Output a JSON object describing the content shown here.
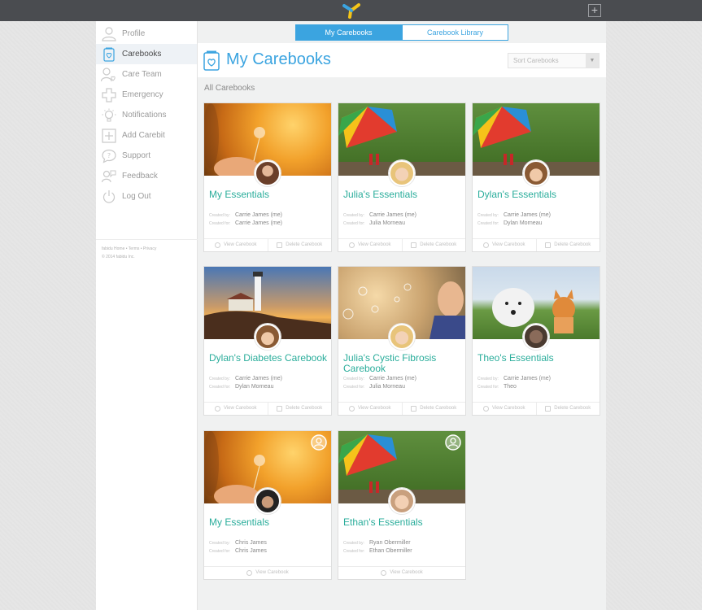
{
  "topbar": {
    "logo_icon": "carebook-logo-icon",
    "add_label": "+"
  },
  "colors": {
    "accent_blue": "#3ba4e0",
    "title_teal": "#2aad9b",
    "topbar": "#4a4c50"
  },
  "sidebar": {
    "items": [
      {
        "label": "Profile",
        "icon": "person-icon"
      },
      {
        "label": "Carebooks",
        "icon": "carebook-icon",
        "active": true
      },
      {
        "label": "Care Team",
        "icon": "care-team-icon"
      },
      {
        "label": "Emergency",
        "icon": "cross-icon"
      },
      {
        "label": "Notifications",
        "icon": "bulb-icon"
      },
      {
        "label": "Add Carebit",
        "icon": "plus-square-icon"
      },
      {
        "label": "Support",
        "icon": "speech-bubble-icon"
      },
      {
        "label": "Feedback",
        "icon": "feedback-icon"
      },
      {
        "label": "Log Out",
        "icon": "power-icon"
      }
    ],
    "footer_links": "fabidu Home  •  Terms  •  Privacy",
    "footer_copy": "© 2014 fabidu Inc."
  },
  "tabs": [
    "My Carebooks",
    "Carebook Library"
  ],
  "header": {
    "title": "My Carebooks",
    "sort_placeholder": "Sort Carebooks"
  },
  "section_label": "All Carebooks",
  "labels": {
    "created_by": "Created by:",
    "created_for": "Created for:",
    "view": "View Carebook",
    "delete": "Delete Carebook"
  },
  "cards": [
    {
      "title": "My Essentials",
      "created_by": "Carrie James (me)",
      "created_for": "Carrie James (me)"
    },
    {
      "title": "Julia's Essentials",
      "created_by": "Carrie James (me)",
      "created_for": "Julia Morneau"
    },
    {
      "title": "Dylan's Essentials",
      "created_by": "Carrie James (me)",
      "created_for": "Dylan Morneau"
    },
    {
      "title": "Dylan's Diabetes Carebook",
      "created_by": "Carrie James (me)",
      "created_for": "Dylan Morneau"
    },
    {
      "title": "Julia's Cystic Fibrosis Carebook",
      "created_by": "Carrie James (me)",
      "created_for": "Julia Morneau"
    },
    {
      "title": "Theo's Essentials",
      "created_by": "Carrie James (me)",
      "created_for": "Theo"
    },
    {
      "title": "My Essentials",
      "created_by": "Chris James",
      "created_for": "Chris James"
    },
    {
      "title": "Ethan's Essentials",
      "created_by": "Ryan Obermiller",
      "created_for": "Ethan Obermiller"
    }
  ]
}
